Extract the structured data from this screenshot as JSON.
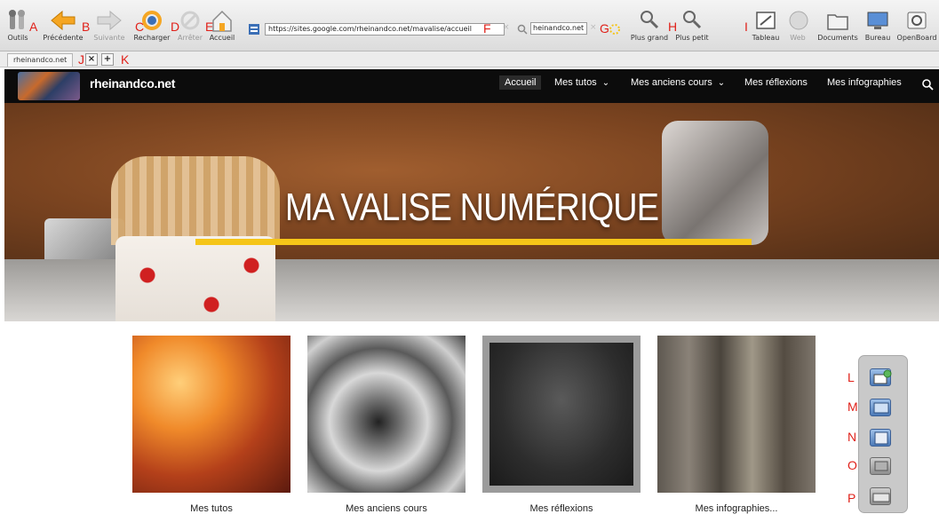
{
  "toolbar": {
    "tools_label": "Outils",
    "previous_label": "Précédente",
    "next_label": "Suivante",
    "reload_label": "Recharger",
    "stop_label": "Arrêter",
    "home_label": "Accueil",
    "url": "https://sites.google.com/rheinandco.net/mavalise/accueil",
    "search_value": "heinandco.net",
    "zoom_in_label": "Plus grand",
    "zoom_out_label": "Plus petit",
    "board_label": "Tableau",
    "web_label": "Web",
    "documents_label": "Documents",
    "desktop_label": "Bureau",
    "openboard_label": "OpenBoard"
  },
  "annotations": {
    "a": "A",
    "b": "B",
    "c": "C",
    "d": "D",
    "e": "E",
    "f": "F",
    "g": "G",
    "h": "H",
    "i": "I",
    "j": "J",
    "k": "K",
    "l": "L",
    "m": "M",
    "n": "N",
    "o": "O",
    "p": "P"
  },
  "tabs": {
    "active_tab": "rheinandco.net",
    "close_glyph": "×",
    "new_glyph": "+"
  },
  "site": {
    "name": "rheinandco.net",
    "nav": [
      "Accueil",
      "Mes tutos",
      "Mes anciens cours",
      "Mes réflexions",
      "Mes infographies"
    ],
    "hero_title": "MA VALISE NUMÉRIQUE",
    "cards": [
      "Mes tutos",
      "Mes anciens cours",
      "Mes réflexions",
      "Mes infographies..."
    ]
  },
  "colors": {
    "accent_underline": "#f5c518",
    "annotation_red": "#e0211a",
    "site_header": "#0c0c0c"
  }
}
